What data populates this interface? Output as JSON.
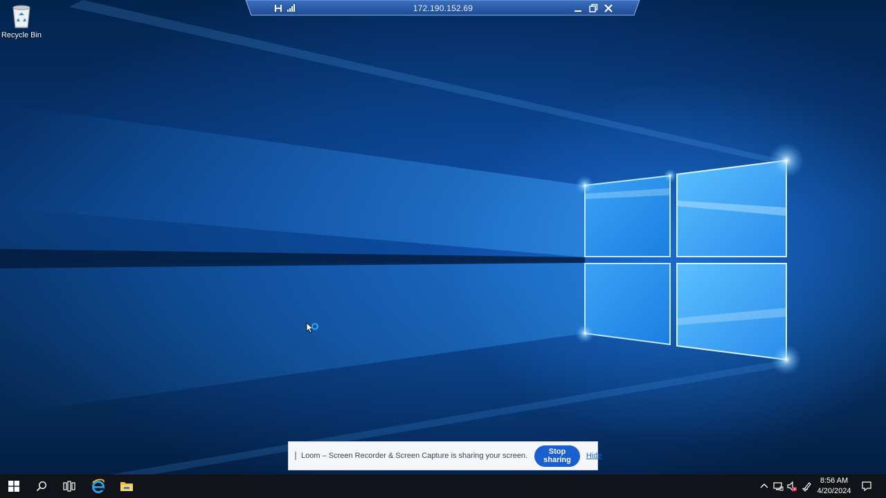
{
  "desktop": {
    "icons": [
      {
        "label": "Recycle Bin",
        "icon": "recycle-bin-icon"
      }
    ]
  },
  "rdp_bar": {
    "host": "172.190.152.69",
    "icons": [
      "pin-icon",
      "signal-strength-icon",
      "minimize-icon",
      "restore-icon",
      "close-icon"
    ]
  },
  "loom": {
    "message": "Loom – Screen Recorder & Screen Capture is sharing your screen.",
    "stop_label": "Stop sharing",
    "hide_label": "Hide"
  },
  "taskbar": {
    "pinned": [
      "start-windows-icon",
      "search-icon",
      "task-view-icon",
      "internet-explorer-icon",
      "file-explorer-icon"
    ],
    "tray": [
      "chevron-up-icon",
      "network-icon",
      "volume-muted-icon",
      "pen-icon",
      "notifications-icon"
    ],
    "time": "8:56 AM",
    "date": "4/20/2024"
  },
  "colors": {
    "taskbar_bg": "#101317",
    "loom_button": "#1a5fd0",
    "rdp_bar": "#2a5ca8",
    "wallpaper_glow": "#55b6ff"
  }
}
